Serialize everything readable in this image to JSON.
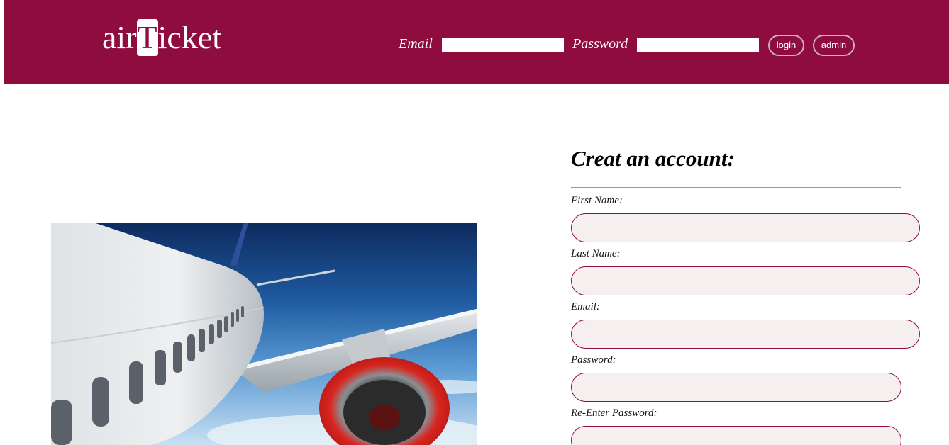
{
  "header": {
    "logo": {
      "prefix": "air",
      "boxed_letter": "T",
      "suffix": "icket"
    },
    "email_label": "Email",
    "email_value": "",
    "password_label": "Password",
    "password_value": "",
    "login_label": "login",
    "admin_label": "admin"
  },
  "hero": {
    "icon": "airplane-wing-photo"
  },
  "form": {
    "title": "Creat an account:",
    "fields": [
      {
        "label": "First Name:",
        "value": ""
      },
      {
        "label": "Last Name:",
        "value": ""
      },
      {
        "label": "Email:",
        "value": ""
      },
      {
        "label": "Password:",
        "value": ""
      },
      {
        "label": "Re-Enter Password:",
        "value": ""
      }
    ]
  },
  "colors": {
    "brand": "#8f0c3e",
    "input_fill": "#f5eff0"
  }
}
